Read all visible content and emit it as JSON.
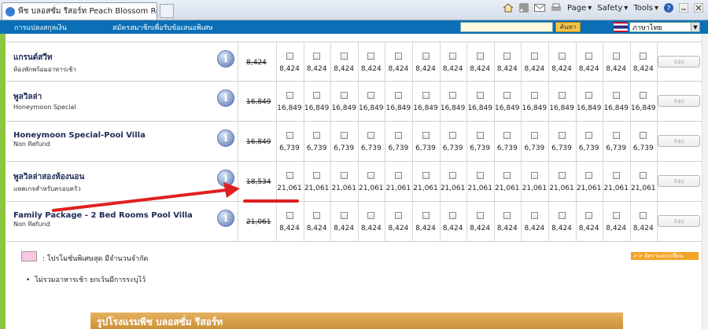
{
  "browser": {
    "tab_title": "พีช บลอสซั่ม รีสอร์ท Peach Blossom Resort - โรงแรม...",
    "commands": [
      "Page",
      "Safety",
      "Tools"
    ]
  },
  "nav": {
    "links": [
      "การแปลงสกุลเงิน",
      "สมัครสมาชิกเพื่อรับข้อเสนอพิเศษ"
    ],
    "search_placeholder": "",
    "search_button": "ค้นหา",
    "language": "ภาษาไทย"
  },
  "rates": {
    "book_label": "จอง",
    "rows": [
      {
        "name": "แกรนด์สวีท",
        "sub": "ห้องพักพร้อมอาหารเช้า",
        "original": "8,424",
        "price": "8,424"
      },
      {
        "name": "พูลวิลล่า",
        "sub": "Honeymoon Special",
        "original": "16,849",
        "price": "16,849"
      },
      {
        "name": "Honeymoon Special-Pool Villa",
        "sub": "Non Refund",
        "original": "16,849",
        "price": "6,739"
      },
      {
        "name": "พูลวิลล่าสองห้องนอน",
        "sub": "แพคเกจสำหรับครอบครัว",
        "original": "18,534",
        "price": "21,061"
      },
      {
        "name": "Family Package - 2 Bed Rooms Pool Villa",
        "sub": "Non Refund",
        "original": "21,061",
        "price": "8,424"
      }
    ]
  },
  "legend": {
    "promo": ": โปรโมชั่นพิเศษสุด มีจำนวนจำกัด",
    "note": "ไม่รวมอาหารเช้า ยกเว้นมีการระบุไว้",
    "exchange": ">> อัตราแลกเปลี่ยน"
  },
  "photos_header": "รูปโรงแรมพีช บลอสซั่ม รีสอร์ท",
  "colors": {
    "nav": "#0a6fb4",
    "accent_green": "#8ec63f",
    "annotation": "#e02020",
    "promo": "#fbc7e3"
  }
}
